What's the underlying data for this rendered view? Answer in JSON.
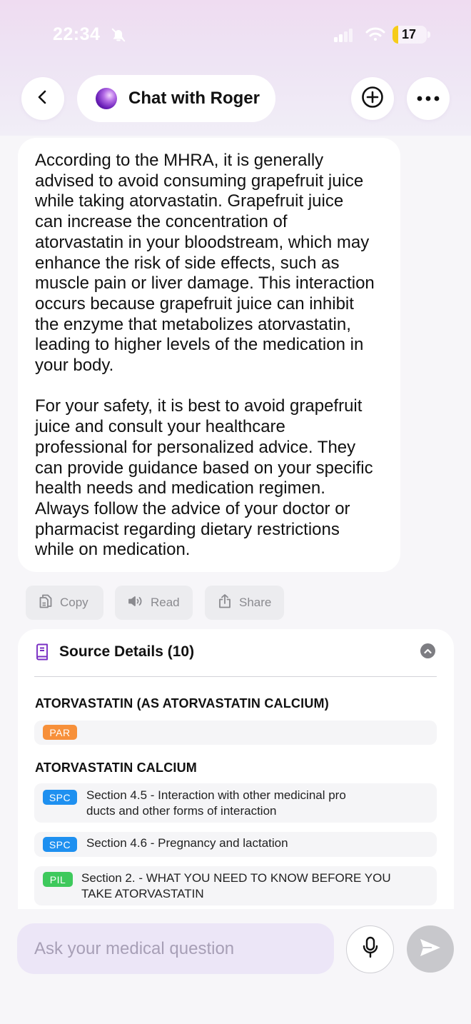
{
  "status_bar": {
    "time": "22:34",
    "battery_level": "17",
    "battery_fraction": 0.17
  },
  "header": {
    "title": "Chat with Roger",
    "icons": {
      "back": "chevron-left-icon",
      "new": "plus-circle-icon",
      "more": "ellipsis-icon"
    }
  },
  "message": {
    "paragraphs": [
      "According to the MHRA, it is generally\nadvised to avoid consuming grapefruit juice\nwhile taking atorvastatin. Grapefruit juice\ncan increase the concentration of\natorvastatin in your bloodstream, which may\nenhance the risk of side effects, such as\nmuscle pain or liver damage. This interaction\noccurs because grapefruit juice can inhibit\nthe enzyme that metabolizes atorvastatin,\nleading to higher levels of the medication in\nyour body.",
      "For your safety, it is best to avoid grapefruit\njuice and consult your healthcare\nprofessional for personalized advice. They\ncan provide guidance based on your specific\nhealth needs and medication regimen.\nAlways follow the advice of your doctor or\npharmacist regarding dietary restrictions\nwhile on medication."
    ]
  },
  "actions": {
    "copy": "Copy",
    "read": "Read",
    "share": "Share"
  },
  "sources": {
    "title": "Source Details (10)",
    "groups": [
      {
        "title": "ATORVASTATIN (AS ATORVASTATIN CALCIUM)",
        "items": [
          {
            "badge": "PAR",
            "text": ""
          }
        ]
      },
      {
        "title": "ATORVASTATIN CALCIUM",
        "items": [
          {
            "badge": "SPC",
            "text": "Section 4.5 - Interaction with other medicinal pro\nducts and other forms of interaction"
          },
          {
            "badge": "SPC",
            "text": "Section 4.6 - Pregnancy and lactation"
          },
          {
            "badge": "PIL",
            "text": "Section 2. - WHAT YOU NEED TO KNOW BEFORE YOU\nTAKE ATORVASTATIN"
          }
        ]
      }
    ]
  },
  "composer": {
    "placeholder": "Ask your medical question"
  },
  "colors": {
    "par": "#f7903a",
    "spc": "#1e90f0",
    "pil": "#3ec95c",
    "accent": "#7a2fc4"
  }
}
